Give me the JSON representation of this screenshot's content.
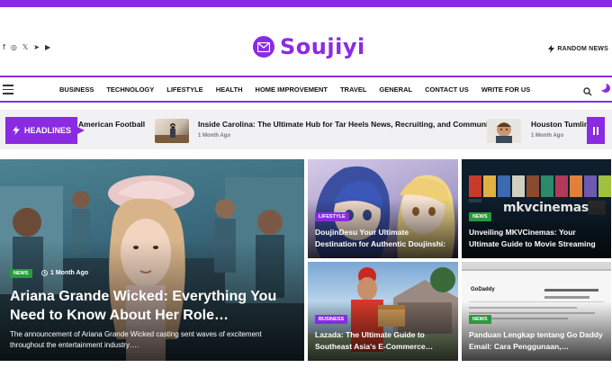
{
  "header": {
    "brand": "Soujiyi",
    "random_news": "RANDOM NEWS",
    "social_icons": [
      "facebook-icon",
      "instagram-icon",
      "x-icon",
      "telegram-icon",
      "youtube-icon"
    ]
  },
  "nav": {
    "items": [
      "BUSINESS",
      "TECHNOLOGY",
      "LIFESTYLE",
      "HEALTH",
      "HOME IMPROVEMENT",
      "TRAVEL",
      "GENERAL",
      "CONTACT US",
      "WRITE FOR US"
    ]
  },
  "ticker": {
    "label": "HEADLINES",
    "items": [
      {
        "title": "American Football"
      },
      {
        "title": "Inside Carolina: The Ultimate Hub for Tar Heels News, Recruiting, and Community",
        "date": "1 Month Ago"
      },
      {
        "title": "Houston Tumlin:",
        "date": "1 Month Ago"
      }
    ]
  },
  "cards": {
    "main": {
      "badge": "NEWS",
      "date": "1 Month Ago",
      "title": "Ariana Grande Wicked: Everything You Need to Know About Her Role…",
      "excerpt": "The announcement of Ariana Grande Wicked casting sent waves of excitement throughout the entertainment industry…."
    },
    "c1": {
      "badge": "LIFESTYLE",
      "title": "DoujinDesu Your Ultimate Destination for Authentic Doujinshi:"
    },
    "c2": {
      "badge": "NEWS",
      "title": "Unveiling MKVCinemas: Your Ultimate Guide to Movie Streaming",
      "logo_text": "mkvcinemas"
    },
    "c3": {
      "badge": "BUSINESS",
      "title": "Lazada: The Ultimate Guide to Southeast Asia's E-Commerce…"
    },
    "c4": {
      "badge": "NEWS",
      "title": "Panduan Lengkap tentang Go Daddy Email: Cara Penggunaan,…",
      "logo_text": "GoDaddy"
    }
  },
  "colors": {
    "accent": "#8a2be2",
    "news_badge": "#2b9a3c"
  }
}
